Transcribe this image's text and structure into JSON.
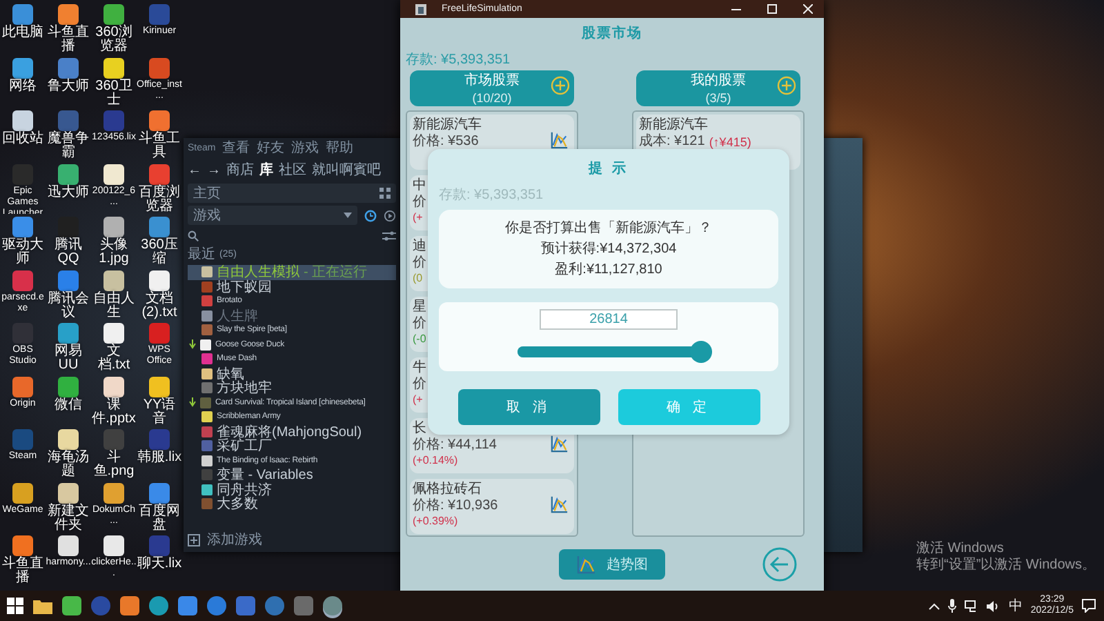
{
  "desktop_icons": [
    {
      "label": "此电脑",
      "color": "#3a8fd8"
    },
    {
      "label": "网络",
      "color": "#3aa0e0"
    },
    {
      "label": "回收站",
      "color": "#c8d4e0"
    },
    {
      "label": "Epic Games Launcher",
      "color": "#2a2a2a"
    },
    {
      "label": "驱动大师",
      "color": "#3a8ee8"
    },
    {
      "label": "parsecd.exe",
      "color": "#d8304a"
    },
    {
      "label": "OBS Studio",
      "color": "#303038"
    },
    {
      "label": "Origin",
      "color": "#e8682a"
    },
    {
      "label": "Steam",
      "color": "#1a4a80"
    },
    {
      "label": "WeGame",
      "color": "#d8a020"
    },
    {
      "label": "斗鱼直播",
      "color": "#f07020"
    },
    {
      "label": "斗鱼直播",
      "color": "#f08030"
    },
    {
      "label": "鲁大师",
      "color": "#4a80c8"
    },
    {
      "label": "魔兽争霸",
      "color": "#385890"
    },
    {
      "label": "迅大师",
      "color": "#38b070"
    },
    {
      "label": "腾讯QQ",
      "color": "#202020"
    },
    {
      "label": "腾讯会议",
      "color": "#2a80e8"
    },
    {
      "label": "网易UU",
      "color": "#28a0c8"
    },
    {
      "label": "微信",
      "color": "#30b040"
    },
    {
      "label": "海龟汤题",
      "color": "#e8d8a0"
    },
    {
      "label": "新建文件夹",
      "color": "#d8c8a0"
    },
    {
      "label": "harmony...",
      "color": "#e0e0e0"
    },
    {
      "label": "360浏览器",
      "color": "#40b040"
    },
    {
      "label": "360卫士",
      "color": "#e8d020"
    },
    {
      "label": "123456.lix",
      "color": "#2a3a90"
    },
    {
      "label": "200122_6...",
      "color": "#f0e8d0"
    },
    {
      "label": "头像1.jpg",
      "color": "#b0b0b0"
    },
    {
      "label": "自由人生",
      "color": "#c8c0a0"
    },
    {
      "label": "文档.txt",
      "color": "#f0f0f0"
    },
    {
      "label": "课件.pptx",
      "color": "#f0d8c8"
    },
    {
      "label": "斗鱼.png",
      "color": "#404040"
    },
    {
      "label": "DokumCh...",
      "color": "#e0a030"
    },
    {
      "label": "clickerHe...",
      "color": "#e8e8e8"
    },
    {
      "label": "Kirinuer",
      "color": "#2a4a98"
    },
    {
      "label": "Office_inst...",
      "color": "#d84a20"
    },
    {
      "label": "斗鱼工具",
      "color": "#f07030"
    },
    {
      "label": "百度浏览器",
      "color": "#e84030"
    },
    {
      "label": "360压缩",
      "color": "#3a90d0"
    },
    {
      "label": "文档(2).txt",
      "color": "#f0f0f0"
    },
    {
      "label": "WPS Office",
      "color": "#d82020"
    },
    {
      "label": "YY语音",
      "color": "#f0c020"
    },
    {
      "label": "韩服.lix",
      "color": "#2a3a90"
    },
    {
      "label": "百度网盘",
      "color": "#3a8ae8"
    },
    {
      "label": "聊天.lix",
      "color": "#2a3a90"
    }
  ],
  "steam": {
    "menu": [
      "Steam",
      "查看",
      "好友",
      "游戏",
      "帮助"
    ],
    "back": "←",
    "forward": "→",
    "tabs": [
      {
        "label": "商店",
        "selected": false
      },
      {
        "label": "库",
        "selected": true
      },
      {
        "label": "社区",
        "selected": false
      },
      {
        "label": "就叫啊賓吧",
        "selected": false
      }
    ],
    "home": "主页",
    "collection": "游戏",
    "section": "最近",
    "section_count": "(25)",
    "games": [
      {
        "name": "自由人生模拟",
        "status": "- 正在运行",
        "selected": true,
        "running": true,
        "installed": true,
        "update": false
      },
      {
        "name": "地下蚁园",
        "selected": false,
        "running": false,
        "installed": true,
        "update": false
      },
      {
        "name": "Brotato",
        "selected": false,
        "running": false,
        "installed": true,
        "update": false
      },
      {
        "name": "人生牌",
        "selected": false,
        "running": false,
        "installed": false,
        "update": false
      },
      {
        "name": "Slay the Spire [beta]",
        "selected": false,
        "running": false,
        "installed": true,
        "update": false
      },
      {
        "name": "Goose Goose Duck",
        "selected": false,
        "running": false,
        "installed": true,
        "update": true
      },
      {
        "name": "Muse Dash",
        "selected": false,
        "running": false,
        "installed": true,
        "update": false
      },
      {
        "name": "缺氧",
        "selected": false,
        "running": false,
        "installed": true,
        "update": false
      },
      {
        "name": "方块地牢",
        "selected": false,
        "running": false,
        "installed": true,
        "update": false
      },
      {
        "name": "Card Survival: Tropical Island [chinesebeta]",
        "selected": false,
        "running": false,
        "installed": true,
        "update": true
      },
      {
        "name": "Scribbleman Army",
        "selected": false,
        "running": false,
        "installed": true,
        "update": false
      },
      {
        "name": "雀魂麻将(MahjongSoul)",
        "selected": false,
        "running": false,
        "installed": true,
        "update": false
      },
      {
        "name": "采矿工厂",
        "selected": false,
        "running": false,
        "installed": true,
        "update": false
      },
      {
        "name": "The Binding of Isaac: Rebirth",
        "selected": false,
        "running": false,
        "installed": true,
        "update": false
      },
      {
        "name": "变量 - Variables",
        "selected": false,
        "running": false,
        "installed": true,
        "update": false
      },
      {
        "name": "同舟共济",
        "selected": false,
        "running": false,
        "installed": true,
        "update": false
      },
      {
        "name": "大多数",
        "selected": false,
        "running": false,
        "installed": true,
        "update": false
      }
    ],
    "add_game": "添加游戏"
  },
  "app": {
    "title": "FreeLifeSimulation",
    "heading": "股票市场",
    "balance": "存款: ¥5,393,351",
    "market": {
      "title": "市场股票",
      "count": "(10/20)",
      "stocks": [
        {
          "name": "新能源汽车",
          "price": "价格: ¥536",
          "chart": true
        },
        {
          "name": "中",
          "price": "价",
          "change": "(+",
          "color": "#d0304a",
          "chart": false
        },
        {
          "name": "迪",
          "price": "价",
          "change": "(0",
          "color": "#9a9a30",
          "chart": false
        },
        {
          "name": "星",
          "price": "价",
          "change": "(-0",
          "color": "#3a9a40",
          "chart": false
        },
        {
          "name": "牛",
          "price": "价",
          "change": "(+",
          "color": "#d0304a",
          "chart": false
        },
        {
          "name": "长",
          "price": "价格: ¥44,114",
          "change": "(+0.14%)",
          "color": "#d0304a",
          "chart": true
        },
        {
          "name": "佩格拉砖石",
          "price": "价格: ¥10,936",
          "change": "(+0.39%)",
          "color": "#d0304a",
          "chart": true
        }
      ]
    },
    "mine": {
      "title": "我的股票",
      "count": "(3/5)",
      "stocks": [
        {
          "name": "新能源汽车",
          "cost": "成本: ¥121",
          "gain": "(↑¥415)",
          "color": "#d0304a"
        }
      ]
    },
    "trend_button": "趋势图",
    "dialog": {
      "title": "提 示",
      "balance": "存款: ¥5,393,351",
      "message": [
        "你是否打算出售「新能源汽车」？",
        "预计获得:¥14,372,304",
        "盈利:¥11,127,810"
      ],
      "amount": "26814",
      "slider": {
        "level": 1
      },
      "buttons": [
        {
          "label": "取 消",
          "kind": "cancel"
        },
        {
          "label": "确 定",
          "kind": "confirm"
        }
      ]
    }
  },
  "activation": {
    "title": "激活 Windows",
    "hint": "转到“设置”以激活 Windows。"
  },
  "taskbar": {
    "ime": "中",
    "time": "23:29",
    "date": "2022/12/5"
  }
}
